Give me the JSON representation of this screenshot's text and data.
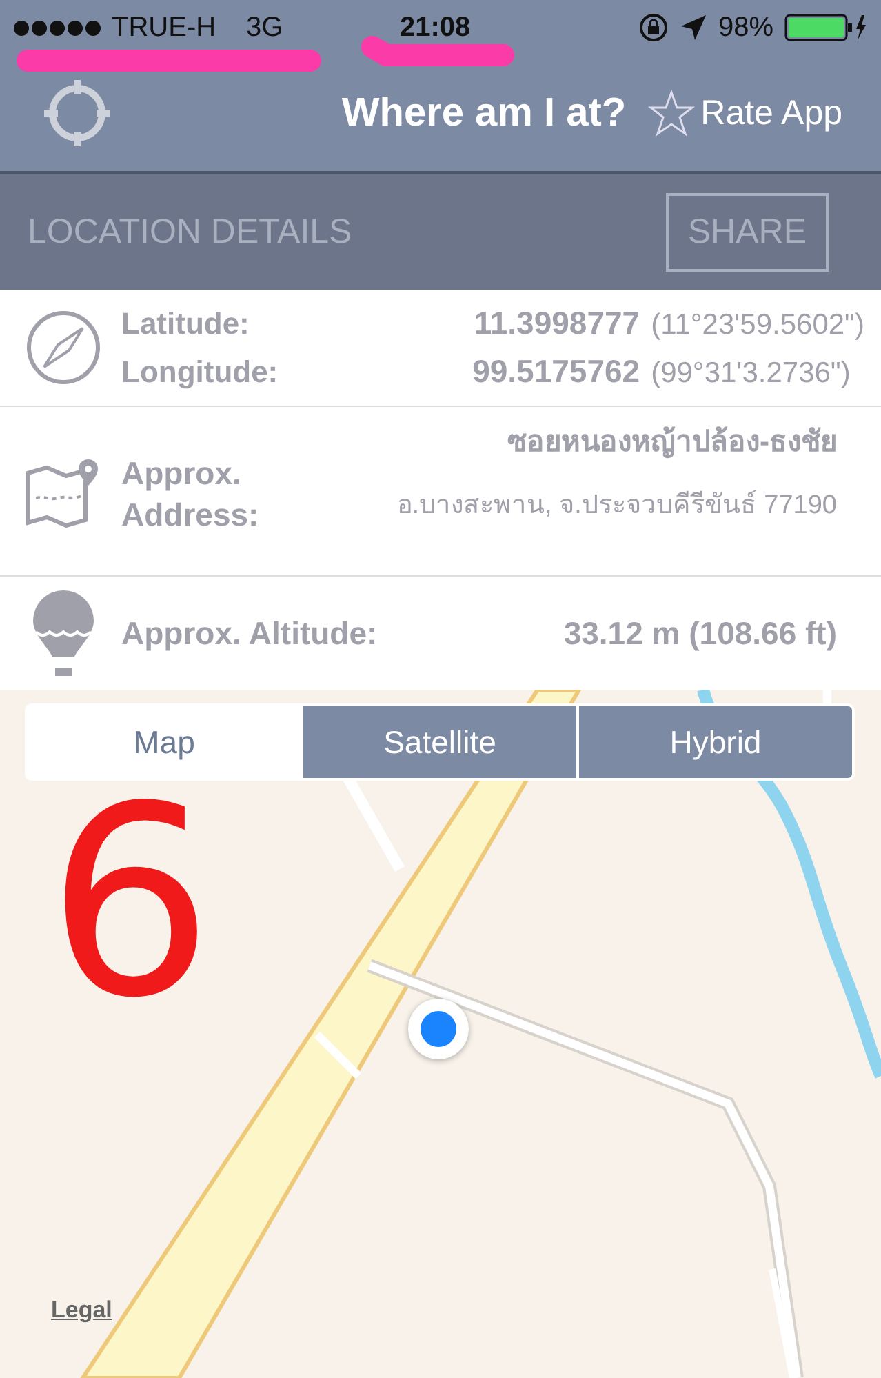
{
  "status_bar": {
    "carrier": "TRUE-H",
    "network": "3G",
    "time": "21:08",
    "battery": "98%"
  },
  "nav": {
    "title": "Where am I at?",
    "rate_button": "Rate App"
  },
  "section": {
    "title": "LOCATION DETAILS",
    "share_button": "SHARE"
  },
  "coordinates": [
    {
      "label": "Latitude:",
      "value": "11.3998777",
      "dms": "(11°23'59.5602\")"
    },
    {
      "label": "Longitude:",
      "value": "99.5175762",
      "dms": "(99°31'3.2736\")"
    }
  ],
  "address": {
    "label": "Approx. Address:",
    "line_1": "ซอยหนองหญ้าปล้อง-ธงชัย",
    "line_2": "อ.บางสะพาน, จ.ประจวบคีรีขันธ์ 77190"
  },
  "altitude": {
    "label": "Approx. Altitude:",
    "value": "33.12 m (108.66 ft)"
  },
  "map_tabs": [
    {
      "label": "Map",
      "selected": true
    },
    {
      "label": "Satellite",
      "selected": false
    },
    {
      "label": "Hybrid",
      "selected": false
    }
  ],
  "map": {
    "kind": "picture",
    "legal_link": "Legal"
  },
  "annotation": {
    "text": "6"
  }
}
